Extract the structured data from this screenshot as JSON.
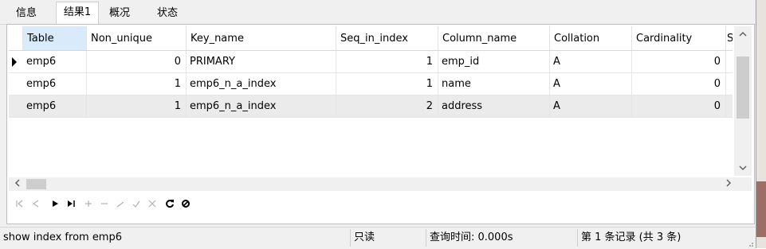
{
  "tabs": [
    {
      "label": "信息"
    },
    {
      "label": "结果1"
    },
    {
      "label": "概况"
    },
    {
      "label": "状态"
    }
  ],
  "grid": {
    "columns": [
      "Table",
      "Non_unique",
      "Key_name",
      "Seq_in_index",
      "Column_name",
      "Collation",
      "Cardinality",
      "S"
    ],
    "rows": [
      [
        "emp6",
        "0",
        "PRIMARY",
        "1",
        "emp_id",
        "A",
        "0"
      ],
      [
        "emp6",
        "1",
        "emp6_n_a_index",
        "1",
        "name",
        "A",
        "0"
      ],
      [
        "emp6",
        "1",
        "emp6_n_a_index",
        "2",
        "address",
        "A",
        "0"
      ]
    ]
  },
  "icons": {
    "first": "first-record-icon",
    "prev": "prev-record-icon",
    "next": "next-record-icon",
    "last": "last-record-icon",
    "add": "add-record-icon",
    "delete": "delete-record-icon",
    "edit": "edit-record-icon",
    "apply": "apply-changes-icon",
    "cancel": "cancel-changes-icon",
    "refresh": "refresh-icon",
    "stop": "stop-icon"
  },
  "status": {
    "query": "show index from emp6",
    "mode": "只读",
    "time": "查询时间: 0.000s",
    "record": "第 1 条记录 (共 3 条)"
  },
  "colors": {
    "selected_header": "#d9ebfa",
    "alt_row": "#ebebeb"
  }
}
